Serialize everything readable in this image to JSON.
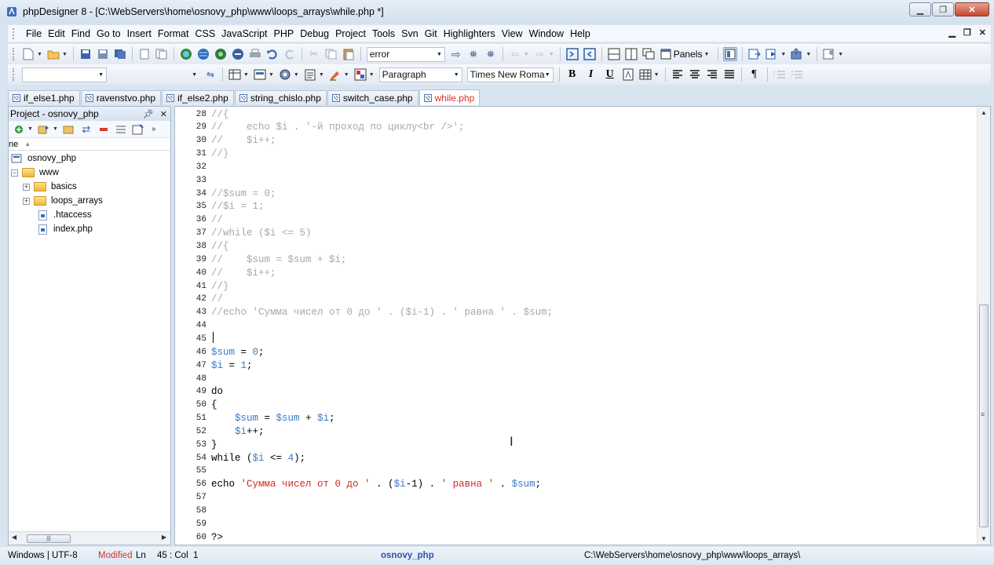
{
  "window": {
    "title": "phpDesigner 8 - [C:\\WebServers\\home\\osnovy_php\\www\\loops_arrays\\while.php *]"
  },
  "menu": [
    "File",
    "Edit",
    "Find",
    "Go to",
    "Insert",
    "Format",
    "CSS",
    "JavaScript",
    "PHP",
    "Debug",
    "Project",
    "Tools",
    "Svn",
    "Git",
    "Highlighters",
    "View",
    "Window",
    "Help"
  ],
  "toolbar": {
    "search_value": "error",
    "panels_label": "Panels",
    "style_combo": "Paragraph",
    "font_combo": "Times New Roma",
    "bold": "B",
    "italic": "I",
    "underline": "U",
    "pilcrow": "¶"
  },
  "tabs": [
    {
      "label": "if_else1.php",
      "active": false
    },
    {
      "label": "ravenstvo.php",
      "active": false
    },
    {
      "label": "if_else2.php",
      "active": false
    },
    {
      "label": "string_chislo.php",
      "active": false
    },
    {
      "label": "switch_case.php",
      "active": false
    },
    {
      "label": "while.php",
      "active": true
    }
  ],
  "project": {
    "title": "Project - osnovy_php",
    "column_header": "ne",
    "tree": [
      {
        "label": "osnovy_php",
        "type": "project"
      },
      {
        "label": "www",
        "type": "folder"
      },
      {
        "label": "basics",
        "type": "folder"
      },
      {
        "label": "loops_arrays",
        "type": "folder"
      },
      {
        "label": ".htaccess",
        "type": "file"
      },
      {
        "label": "index.php",
        "type": "file"
      }
    ]
  },
  "editor": {
    "lines": [
      {
        "n": "28",
        "tokens": [
          [
            "cmt",
            "//{"
          ]
        ]
      },
      {
        "n": "29",
        "tokens": [
          [
            "cmt",
            "//    echo $i . '-й проход по циклу<br />';"
          ]
        ]
      },
      {
        "n": "30",
        "tokens": [
          [
            "cmt",
            "//    $i++;"
          ]
        ]
      },
      {
        "n": "31",
        "tokens": [
          [
            "cmt",
            "//}"
          ]
        ]
      },
      {
        "n": "32",
        "tokens": []
      },
      {
        "n": "33",
        "tokens": []
      },
      {
        "n": "34",
        "tokens": [
          [
            "cmt",
            "//$sum = 0;"
          ]
        ]
      },
      {
        "n": "35",
        "tokens": [
          [
            "cmt",
            "//$i = 1;"
          ]
        ]
      },
      {
        "n": "36",
        "tokens": [
          [
            "cmt",
            "//"
          ]
        ]
      },
      {
        "n": "37",
        "tokens": [
          [
            "cmt",
            "//while ($i <= 5)"
          ]
        ]
      },
      {
        "n": "38",
        "tokens": [
          [
            "cmt",
            "//{"
          ]
        ]
      },
      {
        "n": "39",
        "tokens": [
          [
            "cmt",
            "//    $sum = $sum + $i;"
          ]
        ]
      },
      {
        "n": "40",
        "tokens": [
          [
            "cmt",
            "//    $i++;"
          ]
        ]
      },
      {
        "n": "41",
        "tokens": [
          [
            "cmt",
            "//}"
          ]
        ]
      },
      {
        "n": "42",
        "tokens": [
          [
            "cmt",
            "//"
          ]
        ]
      },
      {
        "n": "43",
        "tokens": [
          [
            "cmt",
            "//echo 'Сумма чисел от 0 до ' . ($i-1) . ' равна ' . $sum;"
          ]
        ]
      },
      {
        "n": "44",
        "tokens": []
      },
      {
        "n": "45",
        "tokens": [
          [
            "caret",
            ""
          ]
        ]
      },
      {
        "n": "46",
        "tokens": [
          [
            "var",
            "$sum"
          ],
          [
            "op",
            " = "
          ],
          [
            "num",
            "0"
          ],
          [
            "op",
            ";"
          ]
        ]
      },
      {
        "n": "47",
        "tokens": [
          [
            "var",
            "$i"
          ],
          [
            "op",
            " = "
          ],
          [
            "num",
            "1"
          ],
          [
            "op",
            ";"
          ]
        ]
      },
      {
        "n": "48",
        "tokens": []
      },
      {
        "n": "49",
        "tokens": [
          [
            "kw",
            "do"
          ]
        ]
      },
      {
        "n": "50",
        "tokens": [
          [
            "op",
            "{"
          ]
        ]
      },
      {
        "n": "51",
        "tokens": [
          [
            "op",
            "    "
          ],
          [
            "var",
            "$sum"
          ],
          [
            "op",
            " = "
          ],
          [
            "var",
            "$sum"
          ],
          [
            "op",
            " + "
          ],
          [
            "var",
            "$i"
          ],
          [
            "op",
            ";"
          ]
        ]
      },
      {
        "n": "52",
        "tokens": [
          [
            "op",
            "    "
          ],
          [
            "var",
            "$i"
          ],
          [
            "op",
            "++;"
          ]
        ]
      },
      {
        "n": "53",
        "tokens": [
          [
            "op",
            "}"
          ]
        ]
      },
      {
        "n": "54",
        "tokens": [
          [
            "kw",
            "while"
          ],
          [
            "op",
            " ("
          ],
          [
            "var",
            "$i"
          ],
          [
            "op",
            " <= "
          ],
          [
            "num",
            "4"
          ],
          [
            "op",
            ");"
          ]
        ]
      },
      {
        "n": "55",
        "tokens": []
      },
      {
        "n": "56",
        "tokens": [
          [
            "kw",
            "echo"
          ],
          [
            "op",
            " "
          ],
          [
            "str",
            "'Сумма чисел от 0 до '"
          ],
          [
            "op",
            " . ("
          ],
          [
            "var",
            "$i"
          ],
          [
            "op",
            "-1) . "
          ],
          [
            "str",
            "' равна '"
          ],
          [
            "op",
            " . "
          ],
          [
            "var",
            "$sum"
          ],
          [
            "op",
            ";"
          ]
        ]
      },
      {
        "n": "57",
        "tokens": []
      },
      {
        "n": "58",
        "tokens": []
      },
      {
        "n": "59",
        "tokens": []
      },
      {
        "n": "60",
        "tokens": [
          [
            "kw",
            "?>"
          ]
        ]
      }
    ]
  },
  "status": {
    "encoding": "Windows | UTF-8",
    "modified": "Modified",
    "ln_label": "Ln",
    "position": "45 : Col",
    "col": "1",
    "project": "osnovy_php",
    "path": "C:\\WebServers\\home\\osnovy_php\\www\\loops_arrays\\"
  }
}
